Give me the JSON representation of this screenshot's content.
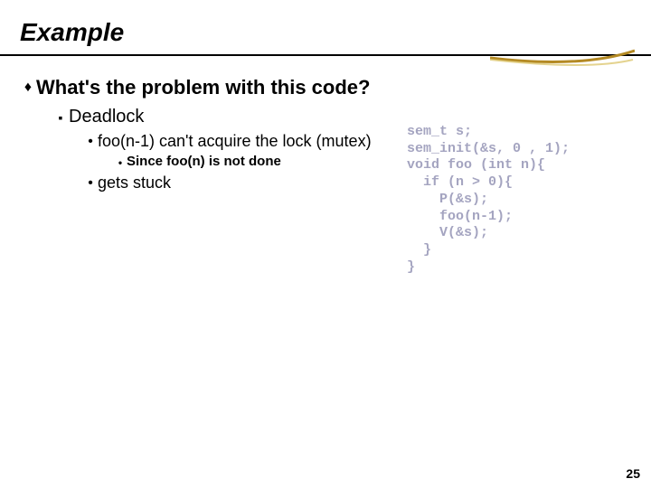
{
  "title": "Example",
  "level1": "What's the problem with this code?",
  "level2": "Deadlock",
  "level3a": "foo(n-1) can't acquire the lock (mutex)",
  "level4a": "Since foo(n) is not done",
  "level3b": "gets stuck",
  "code": {
    "l1": "sem_t s;",
    "l2": "sem_init(&s, 0 , 1);",
    "l3": "void foo (int n){",
    "l4": "  if (n > 0){",
    "l5": "    P(&s);",
    "l6": "    foo(n-1);",
    "l7": "    V(&s);",
    "l8": "  }",
    "l9": "}"
  },
  "pageNumber": "25"
}
